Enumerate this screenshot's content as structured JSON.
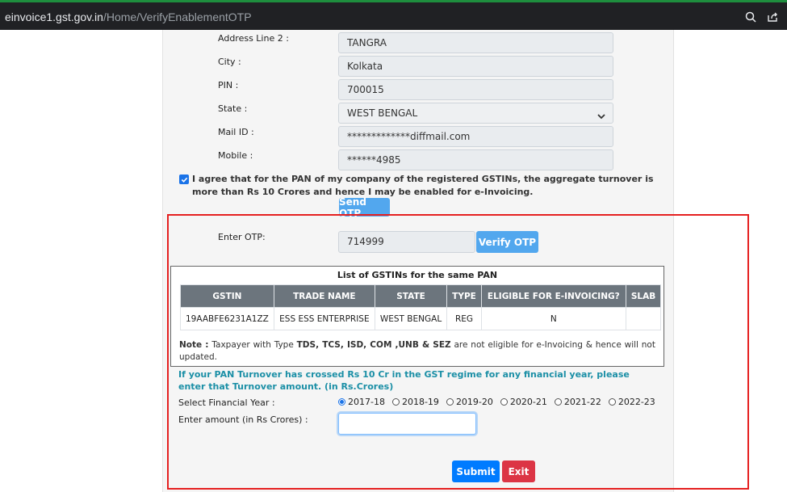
{
  "browser": {
    "url_host": "einvoice1.gst.gov.in",
    "url_path": "/Home/VerifyEnablementOTP"
  },
  "address": {
    "line2_label": "Address Line 2 :",
    "line2_value": "TANGRA",
    "city_label": "City :",
    "city_value": "Kolkata",
    "pin_label": "PIN :",
    "pin_value": "700015",
    "state_label": "State :",
    "state_value": "WEST BENGAL",
    "mail_label": "Mail ID :",
    "mail_value": "*************diffmail.com",
    "mobile_label": "Mobile :",
    "mobile_value": "******4985"
  },
  "agreement": {
    "text": "I agree that for the PAN of my company of the registered GSTINs, the aggregate turnover is more than Rs 10 Crores and hence I may be enabled for e-Invoicing.",
    "checked": true
  },
  "otp": {
    "send_label": "Send OTP",
    "enter_label": "Enter OTP:",
    "value": "714999",
    "verify_label": "Verify OTP"
  },
  "gstin_table": {
    "title": "List of GSTINs for the same PAN",
    "headers": [
      "GSTIN",
      "TRADE NAME",
      "STATE",
      "TYPE",
      "ELIGIBLE FOR E-INVOICING?",
      "SLAB"
    ],
    "rows": [
      [
        "19AABFE6231A1ZZ",
        "ESS ESS ENTERPRISE",
        "WEST BENGAL",
        "REG",
        "N",
        ""
      ]
    ],
    "note_label": "Note :",
    "note_text_1": " Taxpayer with Type ",
    "note_types": "TDS, TCS, ISD, COM ,UNB & SEZ",
    "note_text_2": " are not eligible for e-Invoicing & hence will not updated."
  },
  "turnover": {
    "question": "If your PAN Turnover has crossed Rs 10 Cr in the GST regime for any financial year, please enter that Turnover amount. (in Rs.Crores)",
    "fy_label": "Select Financial Year :",
    "years": [
      "2017-18",
      "2018-19",
      "2019-20",
      "2020-21",
      "2021-22",
      "2022-23"
    ],
    "selected_year": "2017-18",
    "amount_label": "Enter amount (in Rs Crores) :",
    "amount_value": ""
  },
  "actions": {
    "submit_label": "Submit",
    "exit_label": "Exit"
  },
  "colors": {
    "highlight_border": "#e52020",
    "accent_blue": "#007bff",
    "light_blue": "#52a7ee",
    "danger": "#dc3545",
    "teal_text": "#1b8fa6",
    "table_header": "#6c757d"
  },
  "icons": [
    "lock-icon",
    "zoom-icon",
    "share-icon",
    "checkmark-icon",
    "chevron-down-icon"
  ]
}
